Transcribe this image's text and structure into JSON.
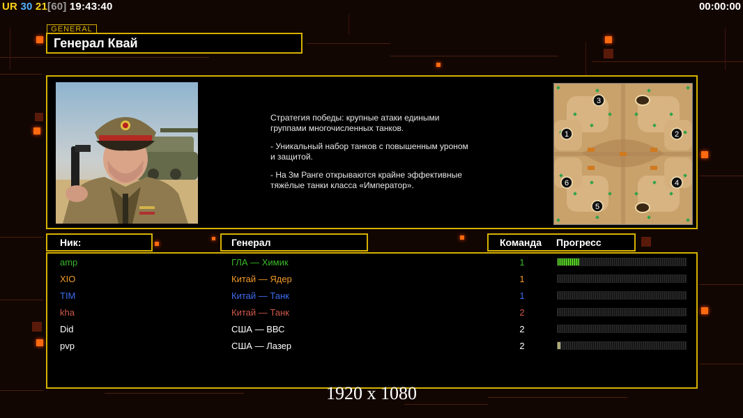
{
  "hud": {
    "ur": "UR",
    "fps": "30",
    "ping": "21",
    "ping_max": "[60]",
    "clock": "19:43:40",
    "timer": "00:00:00"
  },
  "general": {
    "tag": "GENERAL",
    "name": "Генерал Квай"
  },
  "description": [
    "Стратегия победы: крупные атаки едиными\n группами многочисленных танков.",
    "- Уникальный набор танков с повышенным уроном\n и защитой.",
    "- На 3м Ранге открываются крайне эффективные\n тяжёлые танки класса «Император»."
  ],
  "minimap": {
    "start_positions": [
      "1",
      "2",
      "3",
      "4",
      "5",
      "6"
    ]
  },
  "headers": {
    "nick": "Ник:",
    "general": "Генерал",
    "team": "Команда",
    "progress": "Прогресс"
  },
  "players": [
    {
      "nick": "amp",
      "general": "ГЛА — Химик",
      "team": "1",
      "color": "#39b82a",
      "progress": 0.17,
      "bar_style": "green"
    },
    {
      "nick": "XIO",
      "general": "Китай — Ядер",
      "team": "1",
      "color": "#f49a28",
      "progress": 0,
      "bar_style": "green"
    },
    {
      "nick": "TIM",
      "general": "Китай — Танк",
      "team": "1",
      "color": "#3d6cf0",
      "progress": 0,
      "bar_style": "green"
    },
    {
      "nick": "kha",
      "general": "Китай — Танк",
      "team": "2",
      "color": "#d0584a",
      "progress": 0,
      "bar_style": "green"
    },
    {
      "nick": "Did",
      "general": "США — ВВС",
      "team": "2",
      "color": "#ffffff",
      "progress": 0,
      "bar_style": "green"
    },
    {
      "nick": "pvp",
      "general": "США — Лазер",
      "team": "2",
      "color": "#ffffff",
      "progress": 0.02,
      "bar_style": "pale"
    }
  ],
  "resolution": "1920 x 1080"
}
